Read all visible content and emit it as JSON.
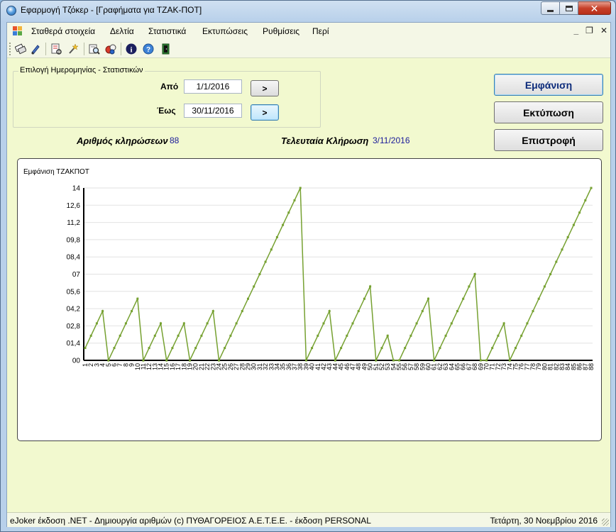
{
  "window": {
    "title": "Εφαρμογή Τζόκερ - [Γραφήματα για ΤΖΑΚ-ΠΟΤ]"
  },
  "menu": {
    "items": [
      "Σταθερά στοιχεία",
      "Δελτία",
      "Στατιστικά",
      "Εκτυπώσεις",
      "Ρυθμίσεις",
      "Περί"
    ]
  },
  "toolbar": {
    "icons": [
      "tickets-icon",
      "pen-icon",
      "report-icon",
      "wand-icon",
      "search-report-icon",
      "balls-icon",
      "info-icon",
      "help-icon",
      "exit-icon"
    ]
  },
  "date_group": {
    "title": "Επιλογή Ημερομηνίας - Στατιστικών",
    "from_label": "Από",
    "from_value": "1/1/2016",
    "to_label": "Έως",
    "to_value": "30/11/2016",
    "arrow_label": ">"
  },
  "actions": {
    "show": "Εμφάνιση",
    "print": "Εκτύπωση",
    "back": "Επιστροφή"
  },
  "info": {
    "draws_label": "Αριθμός κληρώσεων",
    "draws_value": "88",
    "last_draw_label": "Τελευταία Κλήρωση",
    "last_draw_value": "3/11/2016"
  },
  "chart_data": {
    "type": "line",
    "title": "Εμφάνιση ΤΖΑΚΠΟΤ",
    "line_color": "#76a131",
    "ylim": [
      0,
      14
    ],
    "y_ticks": [
      "00",
      "01,4",
      "02,8",
      "04,2",
      "05,6",
      "07",
      "08,4",
      "09,8",
      "11,2",
      "12,6",
      "14"
    ],
    "y_tick_values": [
      0,
      1.4,
      2.8,
      4.2,
      5.6,
      7,
      8.4,
      9.8,
      11.2,
      12.6,
      14
    ],
    "x": [
      1,
      2,
      3,
      4,
      5,
      6,
      7,
      8,
      9,
      10,
      11,
      12,
      13,
      14,
      15,
      16,
      17,
      18,
      19,
      20,
      21,
      22,
      23,
      24,
      25,
      26,
      27,
      28,
      29,
      30,
      31,
      32,
      33,
      34,
      35,
      36,
      37,
      38,
      39,
      40,
      41,
      42,
      43,
      44,
      45,
      46,
      47,
      48,
      49,
      50,
      51,
      52,
      53,
      54,
      55,
      56,
      57,
      58,
      59,
      60,
      61,
      62,
      63,
      64,
      65,
      66,
      67,
      68,
      69,
      70,
      71,
      72,
      73,
      74,
      75,
      76,
      77,
      78,
      79,
      80,
      81,
      82,
      83,
      84,
      85,
      86,
      87,
      88
    ],
    "y": [
      1,
      2,
      3,
      4,
      0,
      1,
      2,
      3,
      4,
      5,
      0,
      1,
      2,
      3,
      0,
      1,
      2,
      3,
      0,
      1,
      2,
      3,
      4,
      0,
      1,
      2,
      3,
      4,
      5,
      6,
      7,
      8,
      9,
      10,
      11,
      12,
      13,
      14,
      0,
      1,
      2,
      3,
      4,
      0,
      1,
      2,
      3,
      4,
      5,
      6,
      0,
      1,
      2,
      0,
      0,
      1,
      2,
      3,
      4,
      5,
      0,
      1,
      2,
      3,
      4,
      5,
      6,
      7,
      0,
      0,
      1,
      2,
      3,
      0,
      1,
      2,
      3,
      4,
      5,
      6,
      7,
      8,
      9,
      10,
      11,
      12,
      13,
      14
    ],
    "grid": true
  },
  "status": {
    "left": "eJoker έκδοση .NET  - Δημιουργία αριθμών  (c) ΠΥΘΑΓΟΡΕΙΟΣ  Α.Ε.Τ.Ε.Ε.  - έκδοση PERSONAL",
    "right": "Τετάρτη, 30 Νοεμβρίου 2016"
  }
}
